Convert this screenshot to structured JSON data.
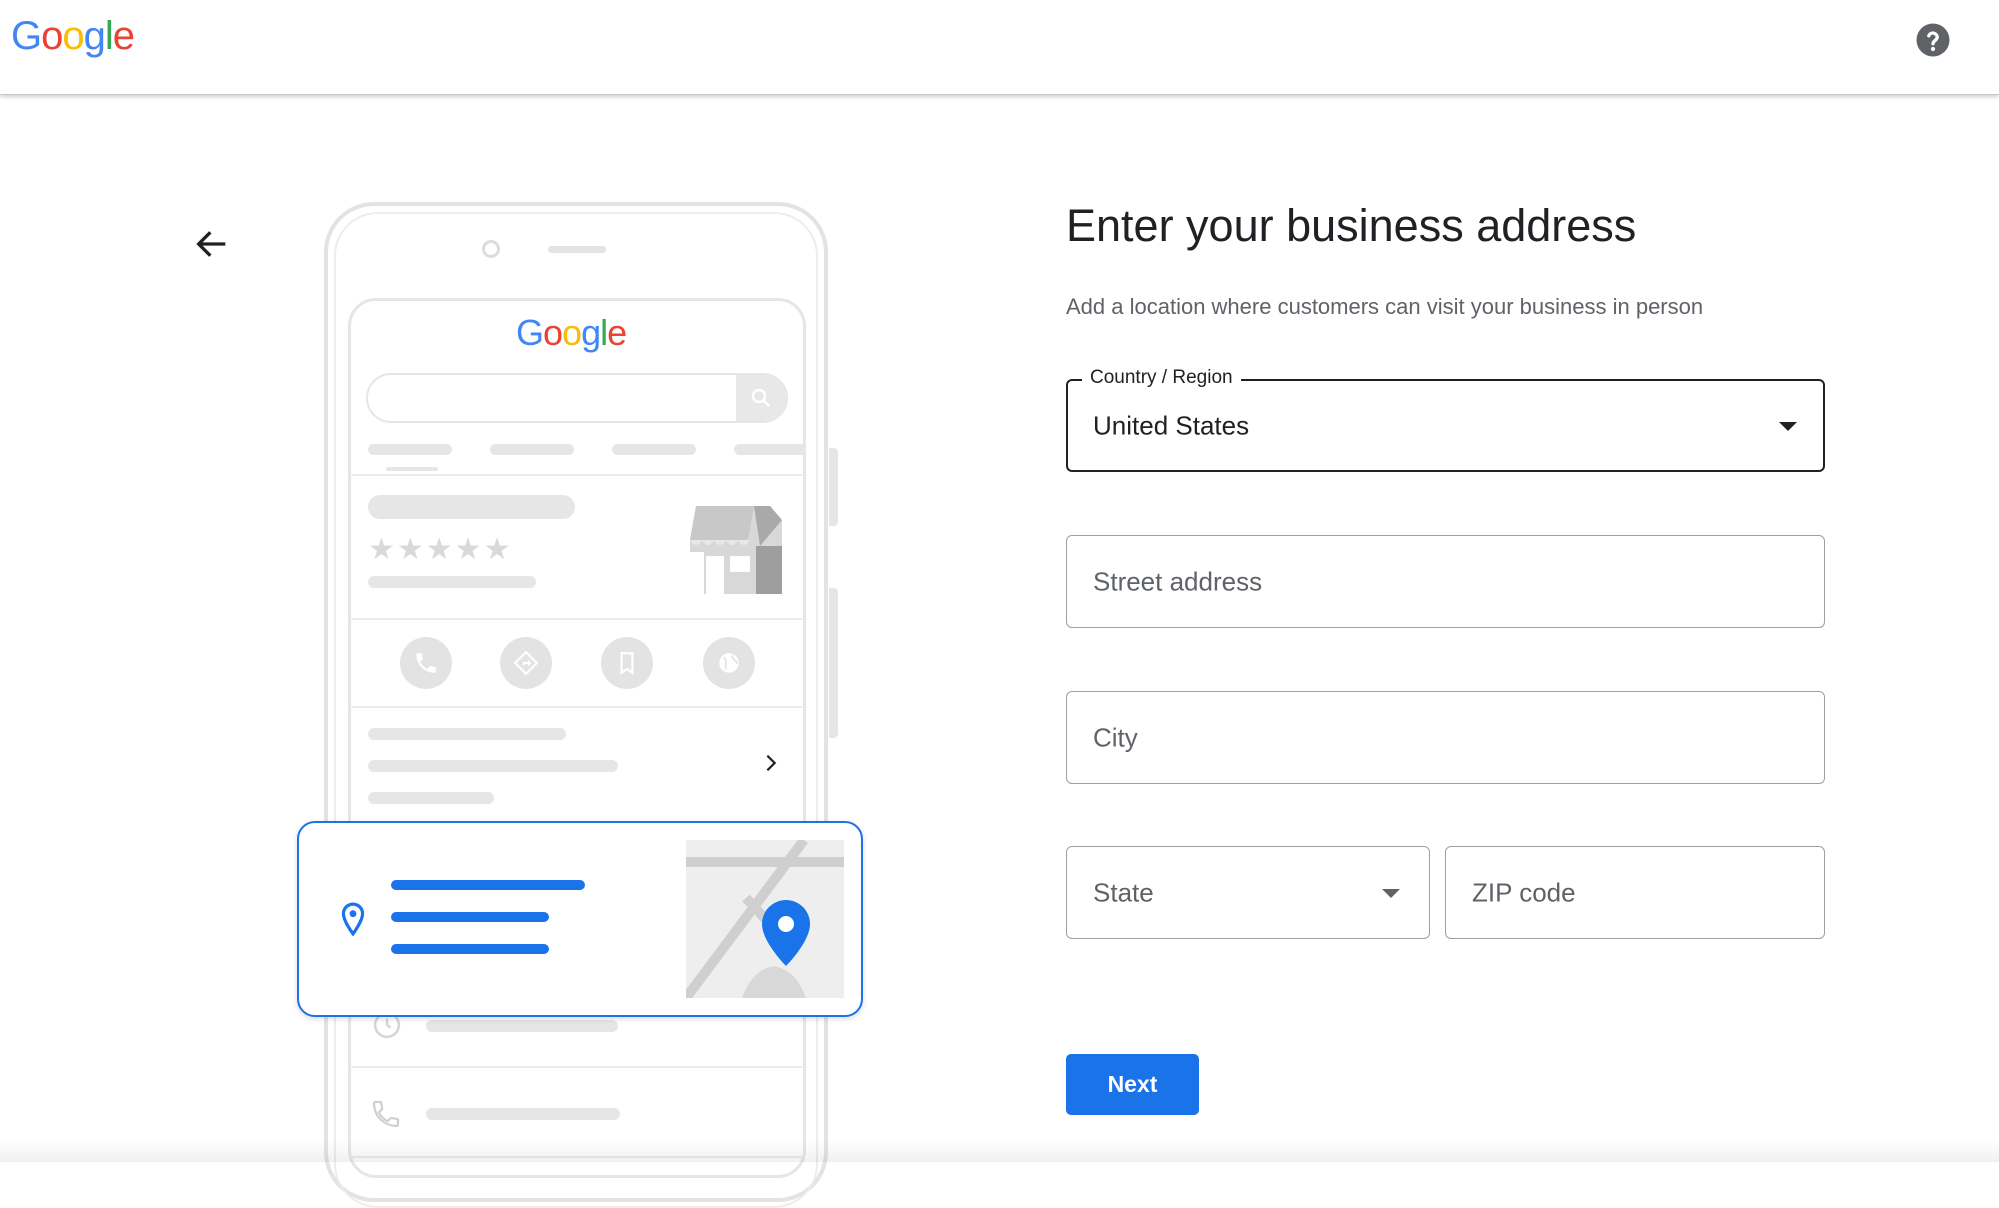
{
  "header": {
    "logo_letters": [
      {
        "ch": "G",
        "color": "#4285F4"
      },
      {
        "ch": "o",
        "color": "#EA4335"
      },
      {
        "ch": "o",
        "color": "#FBBC05"
      },
      {
        "ch": "g",
        "color": "#4285F4"
      },
      {
        "ch": "l",
        "color": "#34A853"
      },
      {
        "ch": "e",
        "color": "#EA4335"
      }
    ],
    "logo_text": "Google",
    "help_icon": "help-circle-icon"
  },
  "nav": {
    "back_icon": "arrow-back-icon"
  },
  "illustration": {
    "screen_logo_text": "Google",
    "stars": "★★★★★",
    "action_icons": [
      "phone-icon",
      "directions-icon",
      "bookmark-icon",
      "globe-icon"
    ]
  },
  "form": {
    "title": "Enter your business address",
    "subtitle": "Add a location where customers can visit your business in person",
    "country": {
      "label": "Country / Region",
      "value": "United States"
    },
    "street": {
      "placeholder": "Street address"
    },
    "city": {
      "placeholder": "City"
    },
    "state": {
      "placeholder": "State"
    },
    "zip": {
      "placeholder": "ZIP code"
    },
    "next_label": "Next"
  },
  "colors": {
    "accent": "#1a73e8",
    "text": "#202124",
    "secondary": "#5f6368"
  }
}
